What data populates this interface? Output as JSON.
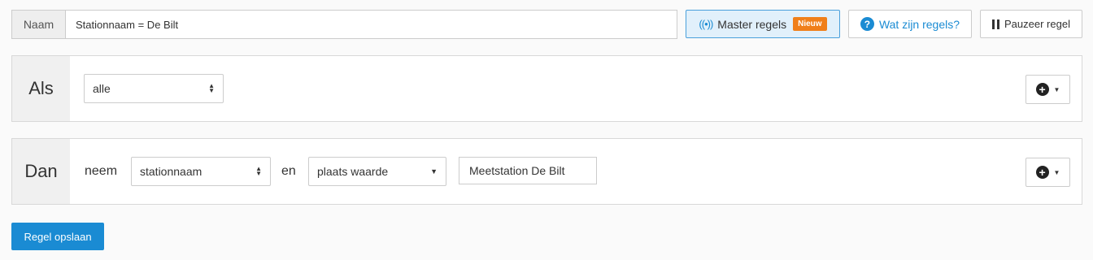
{
  "top_bar": {
    "name_label": "Naam",
    "name_value": "Stationnaam = De Bilt",
    "master_label": "Master regels",
    "new_badge": "Nieuw",
    "help_label": "Wat zijn regels?",
    "pause_label": "Pauzeer regel"
  },
  "als": {
    "heading": "Als",
    "condition_selected": "alle"
  },
  "dan": {
    "heading": "Dan",
    "word_take": "neem",
    "field_selected": "stationnaam",
    "word_and": "en",
    "action_selected": "plaats waarde",
    "value": "Meetstation De Bilt"
  },
  "save_label": "Regel opslaan",
  "colors": {
    "primary": "#1a8bd3",
    "badge": "#f07f1a",
    "master_bg": "#e1f0fb"
  }
}
